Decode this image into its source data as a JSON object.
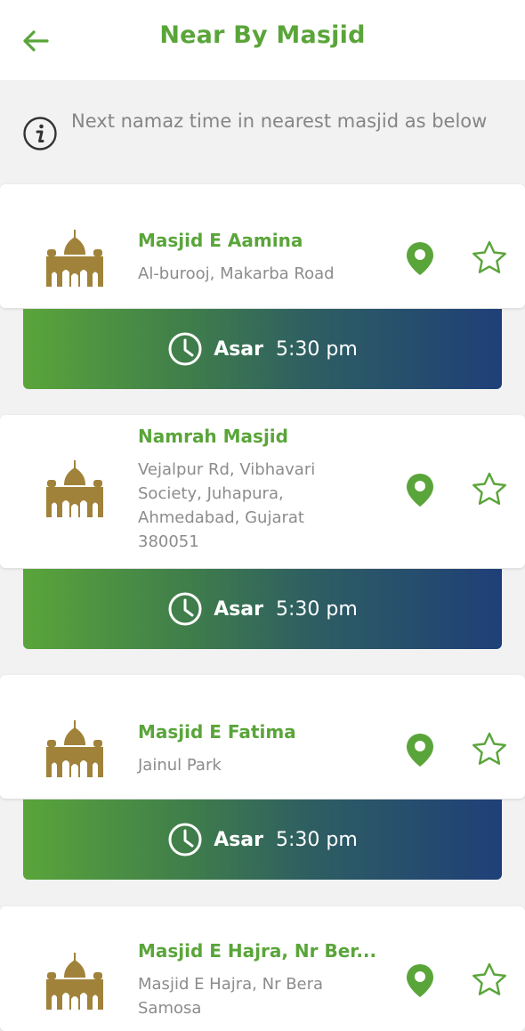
{
  "header": {
    "title": "Near By Masjid"
  },
  "info": {
    "text": "Next namaz time in nearest masjid as below"
  },
  "masjids": [
    {
      "name": "Masjid E Aamina",
      "address": "Al-burooj, Makarba Road",
      "prayer": "Asar",
      "time": "5:30 pm"
    },
    {
      "name": "Namrah Masjid",
      "address": "Vejalpur Rd, Vibhavari Society, Juhapura, Ahmedabad, Gujarat 380051",
      "prayer": "Asar",
      "time": "5:30 pm"
    },
    {
      "name": "Masjid E Fatima",
      "address": "Jainul Park",
      "prayer": "Asar",
      "time": "5:30 pm"
    },
    {
      "name": "Masjid E Hajra, Nr Ber...",
      "address": "Masjid E Hajra, Nr Bera Samosa"
    }
  ],
  "colors": {
    "accent_green": "#5aa53a",
    "mosque_gold": "#a0823a",
    "gradient_end": "#1f3f78"
  },
  "icons": [
    "back-arrow-icon",
    "info-icon",
    "mosque-icon",
    "location-pin-icon",
    "star-icon",
    "clock-icon"
  ]
}
